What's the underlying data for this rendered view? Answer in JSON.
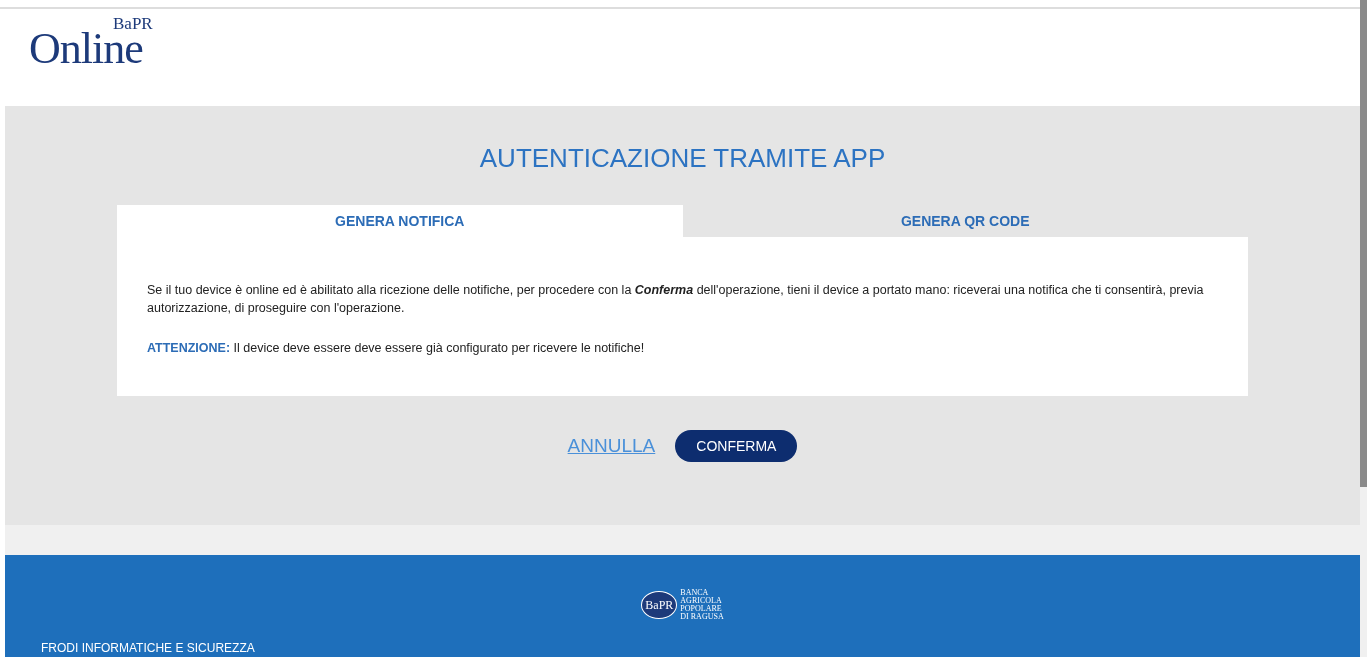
{
  "header": {
    "logo": {
      "word": "Online",
      "mark": "BaPR"
    }
  },
  "title": "AUTENTICAZIONE TRAMITE APP",
  "tabs": [
    {
      "label": "GENERA NOTIFICA",
      "selected": true
    },
    {
      "label": "GENERA QR CODE",
      "selected": false
    }
  ],
  "panel": {
    "paragraphs": [
      {
        "kind": "text",
        "text": "Se il tuo device è online ed è abilitato alla ricezione delle notifiche, per procedere con la **Conferma** dell'operazione, tieni il device a portato mano: riceverai una notifica che ti consentirà, previa autorizzazione, di proseguire con l'operazione."
      },
      {
        "kind": "warning",
        "text": "**ATTENZIONE:** Il device deve essere deve essere già configurato per ricevere le notifiche!"
      }
    ]
  },
  "actions": {
    "cancel": "ANNULLA",
    "confirm": "CONFERMA"
  },
  "footer": {
    "logo": {
      "mark": "BaPR",
      "lines": [
        "BANCA",
        "AGRICOLA",
        "POPOLARE",
        "DI RAGUSA"
      ]
    },
    "section": "FRODI INFORMATICHE E SICUREZZA"
  }
}
